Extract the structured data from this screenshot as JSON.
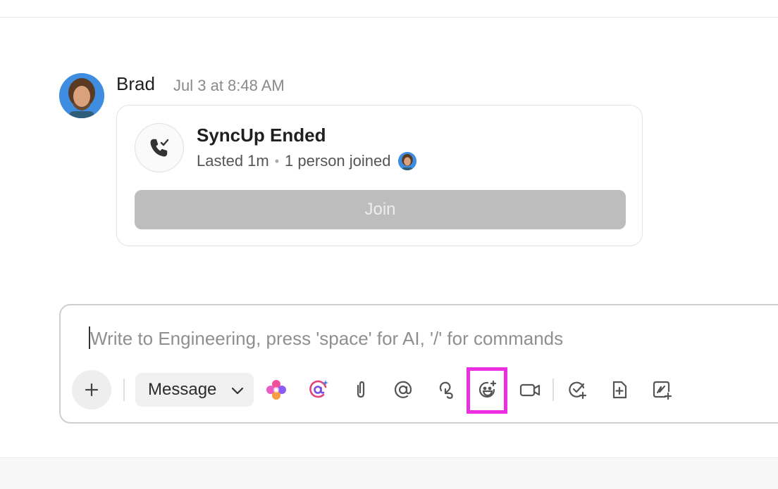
{
  "message": {
    "author": "Brad",
    "timestamp": "Jul 3 at 8:48 AM"
  },
  "call_card": {
    "title": "SyncUp Ended",
    "duration": "Lasted 1m",
    "separator": "•",
    "participants": "1 person joined",
    "join_label": "Join"
  },
  "composer": {
    "placeholder": "Write to Engineering, press 'space' for AI, '/' for commands",
    "mode_label": "Message"
  },
  "toolbar_icons": [
    "plus-icon",
    "chevron-down-icon",
    "ai-sparkle-icon",
    "ai-mention-icon",
    "paperclip-icon",
    "at-mention-icon",
    "clip-record-icon",
    "emoji-plus-icon",
    "video-camera-icon",
    "create-task-icon",
    "create-doc-icon",
    "create-whiteboard-icon"
  ],
  "colors": {
    "accent_highlight": "#ea2ee0",
    "join_disabled": "#bdbdbd",
    "avatar_bg": "#3f8de0"
  }
}
